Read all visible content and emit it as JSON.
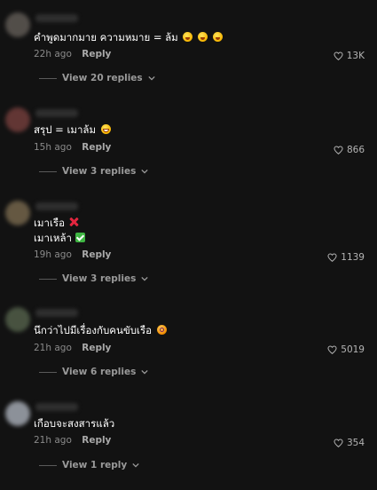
{
  "comments": [
    {
      "text": "คำพูดมากมาย ความหมาย = ล้ม",
      "emojis": [
        "rolling-on-floor-laughing",
        "rolling-on-floor-laughing",
        "rolling-on-floor-laughing"
      ],
      "time": "22h ago",
      "reply_label": "Reply",
      "likes": "13K",
      "view_replies": "View 20 replies",
      "avatar_color": "#5a5550"
    },
    {
      "text": "สรุป = เมาล้ม",
      "emojis": [
        "grinning-squinting-face"
      ],
      "time": "15h ago",
      "reply_label": "Reply",
      "likes": "866",
      "view_replies": "View 3 replies",
      "avatar_color": "#6b3a38"
    },
    {
      "line1": "เมาเรือ",
      "line1_emoji": "cross-mark",
      "line2": "เมาเหล้า",
      "line2_emoji": "check-mark-button",
      "time": "19h ago",
      "reply_label": "Reply",
      "likes": "1139",
      "view_replies": "View 3 replies",
      "avatar_color": "#6e6048"
    },
    {
      "text": "นึกว่าไปมีเรื่องกับคนขับเรือ",
      "emojis": [
        "face-with-spiral-eyes"
      ],
      "time": "21h ago",
      "reply_label": "Reply",
      "likes": "5019",
      "view_replies": "View 6 replies",
      "avatar_color": "#4e5a46"
    },
    {
      "text": "เกือบจะสงสารแล้ว",
      "emojis": [],
      "time": "21h ago",
      "reply_label": "Reply",
      "likes": "354",
      "view_replies": "View 1 reply",
      "avatar_color": "#9a9fa8"
    }
  ],
  "icons": {
    "like": "heart-outline-icon",
    "expand": "chevron-down-icon"
  },
  "colors": {
    "background": "#121212",
    "text": "#ffffff",
    "secondary": "#8a8a8a"
  }
}
